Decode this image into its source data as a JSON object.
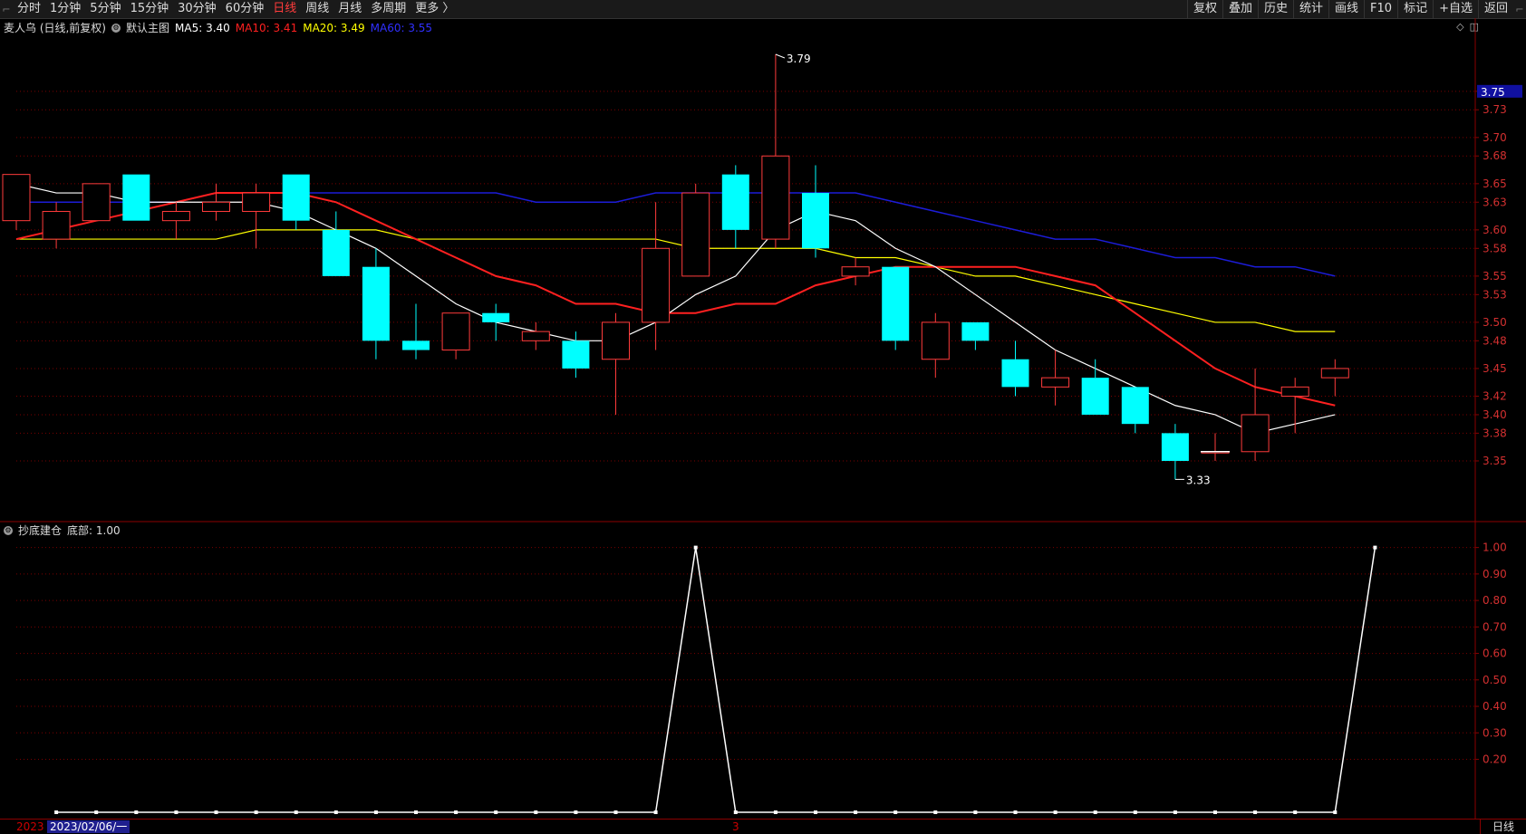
{
  "toolbar": {
    "periods": [
      "分时",
      "1分钟",
      "5分钟",
      "15分钟",
      "30分钟",
      "60分钟",
      "日线",
      "周线",
      "月线",
      "多周期",
      "更多 〉"
    ],
    "active_period": "日线",
    "right_buttons": [
      "复权",
      "叠加",
      "历史",
      "统计",
      "画线",
      "F10",
      "标记",
      "+自选",
      "返回"
    ]
  },
  "main_legend": {
    "stock": "麦人乌 (日线,前复权)",
    "chart_name": "默认主图",
    "ma": [
      {
        "label": "MA5: 3.40",
        "color": "#ffffff"
      },
      {
        "label": "MA10: 3.41",
        "color": "#ff2020"
      },
      {
        "label": "MA20: 3.49",
        "color": "#ffff00"
      },
      {
        "label": "MA60: 3.55",
        "color": "#3030ff"
      }
    ]
  },
  "sub_legend": {
    "name": "抄底建仓",
    "value_label": "底部: 1.00"
  },
  "bottom": {
    "date_prefix": "2023",
    "date": "2023/02/06/一",
    "mark": "3",
    "period_button": "日线"
  },
  "colors": {
    "up": "#ff3b3b",
    "down": "#00ffff",
    "ma5": "#ffffff",
    "ma10": "#ff2020",
    "ma20": "#ffff00",
    "ma60": "#1c1cd8",
    "grid": "#7a0000",
    "signal": "#ffffff",
    "price_tag_bg": "#1010a0"
  },
  "chart_data": [
    {
      "type": "candlestick",
      "ylim": [
        3.3,
        3.79
      ],
      "y_ticks": [
        3.35,
        3.38,
        3.4,
        3.42,
        3.45,
        3.48,
        3.5,
        3.53,
        3.55,
        3.58,
        3.6,
        3.63,
        3.65,
        3.68,
        3.7,
        3.73,
        3.75
      ],
      "current_price": 3.75,
      "high_annotation": "3.79",
      "low_annotation": "3.33",
      "candles": [
        {
          "o": 3.61,
          "c": 3.66,
          "h": 3.66,
          "l": 3.6
        },
        {
          "o": 3.59,
          "c": 3.62,
          "h": 3.63,
          "l": 3.58
        },
        {
          "o": 3.61,
          "c": 3.65,
          "h": 3.65,
          "l": 3.61
        },
        {
          "o": 3.66,
          "c": 3.61,
          "h": 3.66,
          "l": 3.61
        },
        {
          "o": 3.61,
          "c": 3.62,
          "h": 3.63,
          "l": 3.59
        },
        {
          "o": 3.62,
          "c": 3.63,
          "h": 3.65,
          "l": 3.61
        },
        {
          "o": 3.62,
          "c": 3.64,
          "h": 3.65,
          "l": 3.58
        },
        {
          "o": 3.66,
          "c": 3.61,
          "h": 3.66,
          "l": 3.6
        },
        {
          "o": 3.6,
          "c": 3.55,
          "h": 3.62,
          "l": 3.55
        },
        {
          "o": 3.56,
          "c": 3.48,
          "h": 3.58,
          "l": 3.46
        },
        {
          "o": 3.48,
          "c": 3.47,
          "h": 3.52,
          "l": 3.46
        },
        {
          "o": 3.47,
          "c": 3.51,
          "h": 3.51,
          "l": 3.46
        },
        {
          "o": 3.51,
          "c": 3.5,
          "h": 3.52,
          "l": 3.48
        },
        {
          "o": 3.48,
          "c": 3.49,
          "h": 3.5,
          "l": 3.47
        },
        {
          "o": 3.48,
          "c": 3.45,
          "h": 3.49,
          "l": 3.44
        },
        {
          "o": 3.46,
          "c": 3.5,
          "h": 3.51,
          "l": 3.4
        },
        {
          "o": 3.5,
          "c": 3.58,
          "h": 3.63,
          "l": 3.47
        },
        {
          "o": 3.55,
          "c": 3.64,
          "h": 3.65,
          "l": 3.55
        },
        {
          "o": 3.66,
          "c": 3.6,
          "h": 3.67,
          "l": 3.58
        },
        {
          "o": 3.59,
          "c": 3.68,
          "h": 3.79,
          "l": 3.58
        },
        {
          "o": 3.64,
          "c": 3.58,
          "h": 3.67,
          "l": 3.57
        },
        {
          "o": 3.55,
          "c": 3.56,
          "h": 3.57,
          "l": 3.54
        },
        {
          "o": 3.56,
          "c": 3.48,
          "h": 3.56,
          "l": 3.47
        },
        {
          "o": 3.46,
          "c": 3.5,
          "h": 3.51,
          "l": 3.44
        },
        {
          "o": 3.5,
          "c": 3.48,
          "h": 3.5,
          "l": 3.47
        },
        {
          "o": 3.46,
          "c": 3.43,
          "h": 3.48,
          "l": 3.42
        },
        {
          "o": 3.43,
          "c": 3.44,
          "h": 3.47,
          "l": 3.41
        },
        {
          "o": 3.44,
          "c": 3.4,
          "h": 3.46,
          "l": 3.4
        },
        {
          "o": 3.43,
          "c": 3.39,
          "h": 3.43,
          "l": 3.38
        },
        {
          "o": 3.38,
          "c": 3.35,
          "h": 3.39,
          "l": 3.33
        },
        {
          "o": 3.36,
          "c": 3.36,
          "h": 3.38,
          "l": 3.35
        },
        {
          "o": 3.36,
          "c": 3.4,
          "h": 3.45,
          "l": 3.35
        },
        {
          "o": 3.42,
          "c": 3.43,
          "h": 3.44,
          "l": 3.38
        },
        {
          "o": 3.44,
          "c": 3.45,
          "h": 3.46,
          "l": 3.42
        }
      ],
      "ma5": [
        3.65,
        3.64,
        3.64,
        3.63,
        3.63,
        3.63,
        3.63,
        3.62,
        3.6,
        3.58,
        3.55,
        3.52,
        3.5,
        3.49,
        3.48,
        3.48,
        3.5,
        3.53,
        3.55,
        3.6,
        3.62,
        3.61,
        3.58,
        3.56,
        3.53,
        3.5,
        3.47,
        3.45,
        3.43,
        3.41,
        3.4,
        3.38,
        3.39,
        3.4
      ],
      "ma10": [
        3.59,
        3.6,
        3.61,
        3.62,
        3.63,
        3.64,
        3.64,
        3.64,
        3.63,
        3.61,
        3.59,
        3.57,
        3.55,
        3.54,
        3.52,
        3.52,
        3.51,
        3.51,
        3.52,
        3.52,
        3.54,
        3.55,
        3.56,
        3.56,
        3.56,
        3.56,
        3.55,
        3.54,
        3.51,
        3.48,
        3.45,
        3.43,
        3.42,
        3.41
      ],
      "ma20": [
        3.59,
        3.59,
        3.59,
        3.59,
        3.59,
        3.59,
        3.6,
        3.6,
        3.6,
        3.6,
        3.59,
        3.59,
        3.59,
        3.59,
        3.59,
        3.59,
        3.59,
        3.58,
        3.58,
        3.58,
        3.58,
        3.57,
        3.57,
        3.56,
        3.55,
        3.55,
        3.54,
        3.53,
        3.52,
        3.51,
        3.5,
        3.5,
        3.49,
        3.49
      ],
      "ma60": [
        3.63,
        3.63,
        3.63,
        3.63,
        3.63,
        3.64,
        3.64,
        3.64,
        3.64,
        3.64,
        3.64,
        3.64,
        3.64,
        3.63,
        3.63,
        3.63,
        3.64,
        3.64,
        3.64,
        3.64,
        3.64,
        3.64,
        3.63,
        3.62,
        3.61,
        3.6,
        3.59,
        3.59,
        3.58,
        3.57,
        3.57,
        3.56,
        3.56,
        3.55
      ]
    },
    {
      "type": "line",
      "name": "底部",
      "ylim": [
        0,
        1.05
      ],
      "y_ticks": [
        0.2,
        0.3,
        0.4,
        0.5,
        0.6,
        0.7,
        0.8,
        0.9,
        1.0
      ],
      "values": [
        0,
        0,
        0,
        0,
        0,
        0,
        0,
        0,
        0,
        0,
        0,
        0,
        0,
        0,
        0,
        0,
        1,
        0,
        0,
        0,
        0,
        0,
        0,
        0,
        0,
        0,
        0,
        0,
        0,
        0,
        0,
        0,
        0,
        1
      ]
    }
  ]
}
